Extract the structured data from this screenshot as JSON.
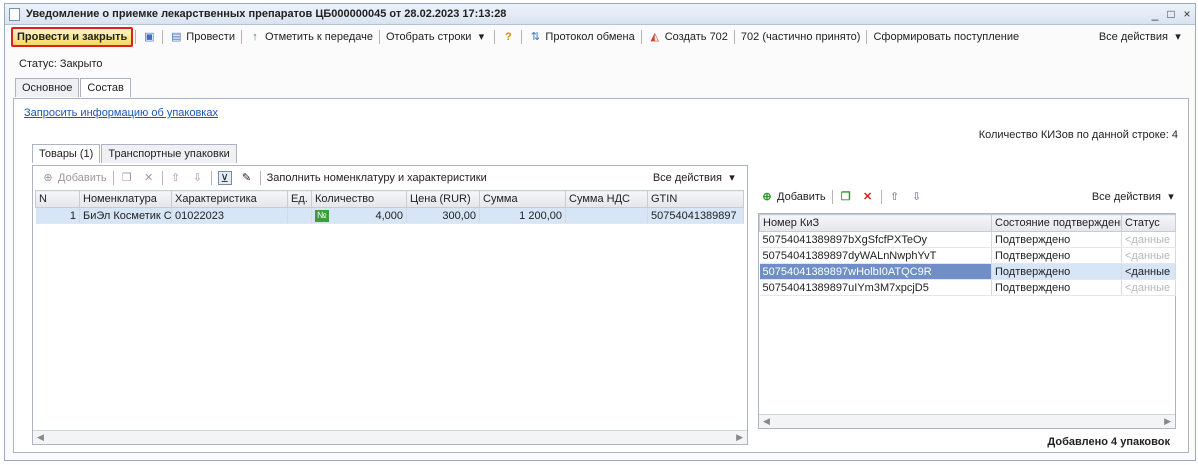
{
  "window": {
    "title": "Уведомление о приемке лекарственных препаратов ЦБ000000045 от 28.02.2023 17:13:28",
    "minimize": "_",
    "maximize": "□",
    "close": "×"
  },
  "toolbar": {
    "post_close": "Провести и закрыть",
    "post": "Провести",
    "mark_transfer": "Отметить к передаче",
    "select_rows": "Отобрать строки",
    "exchange_log": "Протокол обмена",
    "create_702": "Создать 702",
    "partial_702": "702 (частично принято)",
    "form_receipt": "Сформировать поступление",
    "all_actions": "Все действия"
  },
  "status": "Статус: Закрыто",
  "tabs": [
    "Основное",
    "Состав"
  ],
  "request_link": "Запросить информацию об упаковках",
  "kiz_count_label": "Количество КИЗов по данной строке: 4",
  "subtabs": [
    "Товары (1)",
    "Транспортные упаковки"
  ],
  "goods_toolbar": {
    "add": "Добавить",
    "fill": "Заполнить номенклатуру и характеристики",
    "all_actions": "Все действия"
  },
  "goods_table": {
    "columns": [
      "N",
      "Номенклатура",
      "Характеристика",
      "Ед. ...",
      "Количество",
      "Цена (RUR)",
      "Сумма",
      "Сумма НДС",
      "GTIN"
    ],
    "rows": [
      {
        "n": "1",
        "nomenclature": "БиЭл Косметик Со...",
        "characteristic": "01022023",
        "unit": "",
        "qty": "4,000",
        "price": "300,00",
        "sum": "1 200,00",
        "vat": "",
        "gtin": "50754041389897"
      }
    ]
  },
  "kiz_toolbar": {
    "add": "Добавить",
    "all_actions": "Все действия"
  },
  "kiz_table": {
    "columns": [
      "Номер КиЗ",
      "Состояние подтверждения",
      "Статус"
    ],
    "rows": [
      {
        "number": "50754041389897bXgSfcfPXTeOy",
        "state": "Подтверждено",
        "status": "<данные"
      },
      {
        "number": "50754041389897dyWALnNwphYvT",
        "state": "Подтверждено",
        "status": "<данные"
      },
      {
        "number": "50754041389897wHolbI0ATQC9R",
        "state": "Подтверждено",
        "status": "<данные"
      },
      {
        "number": "50754041389897uIYm3M7xpcjD5",
        "state": "Подтверждено",
        "status": "<данные"
      }
    ]
  },
  "added_note": "Добавлено 4 упаковок"
}
